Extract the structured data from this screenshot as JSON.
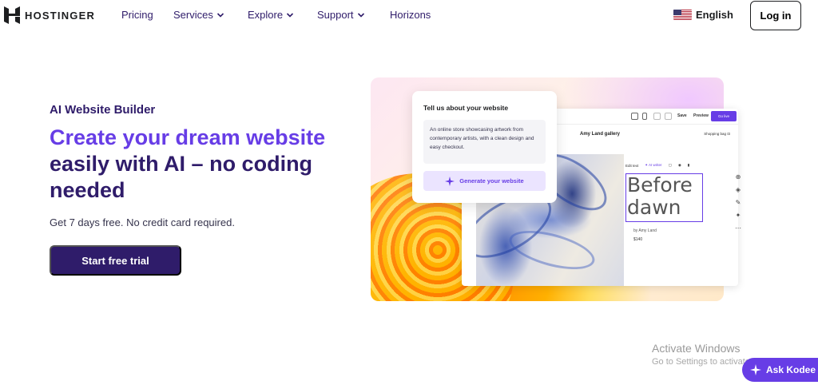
{
  "brand": {
    "name": "HOSTINGER"
  },
  "nav": {
    "items": [
      {
        "label": "Pricing",
        "has_menu": false
      },
      {
        "label": "Services",
        "has_menu": true
      },
      {
        "label": "Explore",
        "has_menu": true
      },
      {
        "label": "Support",
        "has_menu": true
      },
      {
        "label": "Horizons",
        "has_menu": false
      }
    ],
    "language": "English",
    "login": "Log in"
  },
  "hero": {
    "eyebrow": "AI Website Builder",
    "headline_accent": "Create your dream website",
    "headline_rest": " easily with AI – no coding needed",
    "sub": "Get 7 days free. No credit card required.",
    "cta": "Start free trial"
  },
  "preview": {
    "ai_card": {
      "title": "Tell us about your website",
      "prompt": "An online store showcasing artwork from contemporary artists, with a clean design and easy checkout.",
      "button": "Generate your website"
    },
    "editor": {
      "save": "Save",
      "preview": "Preview",
      "go_live": "Go live",
      "site_title": "Amy Land gallery",
      "shopping_bag": "Shopping bag",
      "edit_text": "Edit text",
      "ai_writer": "AI writer",
      "artwork_title": "Before dawn",
      "artist": "by Amy Land",
      "price": "$140"
    }
  },
  "overlay": {
    "activate_title": "Activate Windows",
    "activate_sub": "Go to Settings to activate Windows.",
    "chat": "Ask Kodee"
  },
  "colors": {
    "primary": "#673de6",
    "dark": "#2f1c6a",
    "text": "#1d1e20"
  }
}
